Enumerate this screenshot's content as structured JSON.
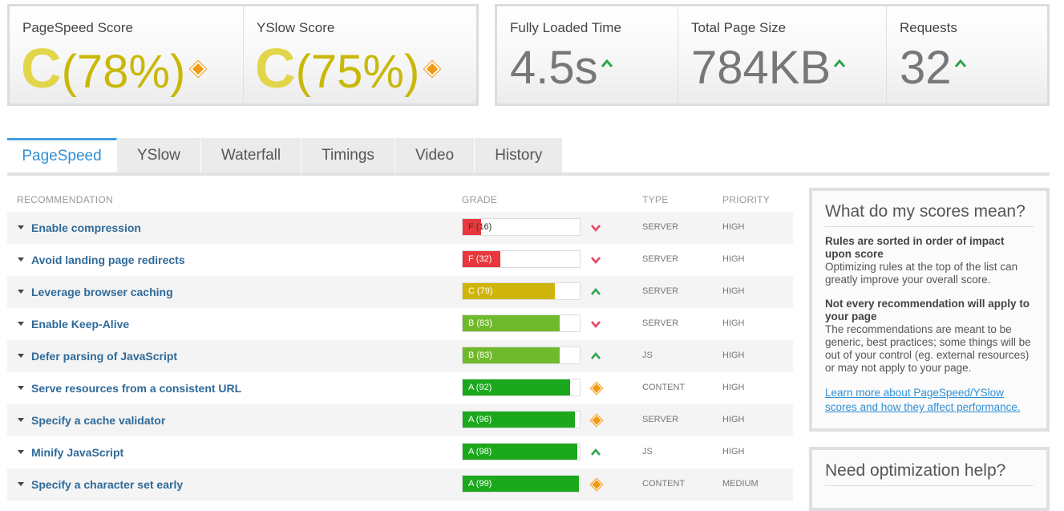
{
  "scores": {
    "pagespeed": {
      "label": "PageSpeed Score",
      "letter": "C",
      "percent": "(78%)"
    },
    "yslow": {
      "label": "YSlow Score",
      "letter": "C",
      "percent": "(75%)"
    }
  },
  "metrics": [
    {
      "label": "Fully Loaded Time",
      "value": "4.5s"
    },
    {
      "label": "Total Page Size",
      "value": "784KB"
    },
    {
      "label": "Requests",
      "value": "32"
    }
  ],
  "tabs": [
    "PageSpeed",
    "YSlow",
    "Waterfall",
    "Timings",
    "Video",
    "History"
  ],
  "table": {
    "headers": {
      "recommendation": "RECOMMENDATION",
      "grade": "GRADE",
      "type": "TYPE",
      "priority": "PRIORITY"
    },
    "rows": [
      {
        "name": "Enable compression",
        "grade": "F",
        "score": 16,
        "grade_label": "F (16)",
        "trend": "down",
        "type": "SERVER",
        "priority": "HIGH"
      },
      {
        "name": "Avoid landing page redirects",
        "grade": "F",
        "score": 32,
        "grade_label": "F (32)",
        "trend": "down",
        "type": "SERVER",
        "priority": "HIGH"
      },
      {
        "name": "Leverage browser caching",
        "grade": "C",
        "score": 79,
        "grade_label": "C (79)",
        "trend": "up",
        "type": "SERVER",
        "priority": "HIGH"
      },
      {
        "name": "Enable Keep-Alive",
        "grade": "B",
        "score": 83,
        "grade_label": "B (83)",
        "trend": "down",
        "type": "SERVER",
        "priority": "HIGH"
      },
      {
        "name": "Defer parsing of JavaScript",
        "grade": "B",
        "score": 83,
        "grade_label": "B (83)",
        "trend": "up",
        "type": "JS",
        "priority": "HIGH"
      },
      {
        "name": "Serve resources from a consistent URL",
        "grade": "A",
        "score": 92,
        "grade_label": "A (92)",
        "trend": "same",
        "type": "CONTENT",
        "priority": "HIGH"
      },
      {
        "name": "Specify a cache validator",
        "grade": "A",
        "score": 96,
        "grade_label": "A (96)",
        "trend": "same",
        "type": "SERVER",
        "priority": "HIGH"
      },
      {
        "name": "Minify JavaScript",
        "grade": "A",
        "score": 98,
        "grade_label": "A (98)",
        "trend": "up",
        "type": "JS",
        "priority": "HIGH"
      },
      {
        "name": "Specify a character set early",
        "grade": "A",
        "score": 99,
        "grade_label": "A (99)",
        "trend": "same",
        "type": "CONTENT",
        "priority": "MEDIUM"
      }
    ]
  },
  "colors": {
    "grade_F": "#e8383d",
    "grade_C": "#cfb50b",
    "grade_B": "#6fba2c",
    "grade_A": "#1ca81c",
    "trend_up": "#2ea44f",
    "trend_down": "#e14b63",
    "trend_same": "#f09a15",
    "accent": "#2f8fd4"
  },
  "sidebar": {
    "scores_box": {
      "title": "What do my scores mean?",
      "p1_bold": "Rules are sorted in order of impact upon score",
      "p1_text": "Optimizing rules at the top of the list can greatly improve your overall score.",
      "p2_bold": "Not every recommendation will apply to your page",
      "p2_text": "The recommendations are meant to be generic, best practices; some things will be out of your control (eg. external resources) or may not apply to your page.",
      "link": "Learn more about PageSpeed/YSlow scores and how they affect performance."
    },
    "help_box": {
      "title": "Need optimization help?"
    }
  }
}
